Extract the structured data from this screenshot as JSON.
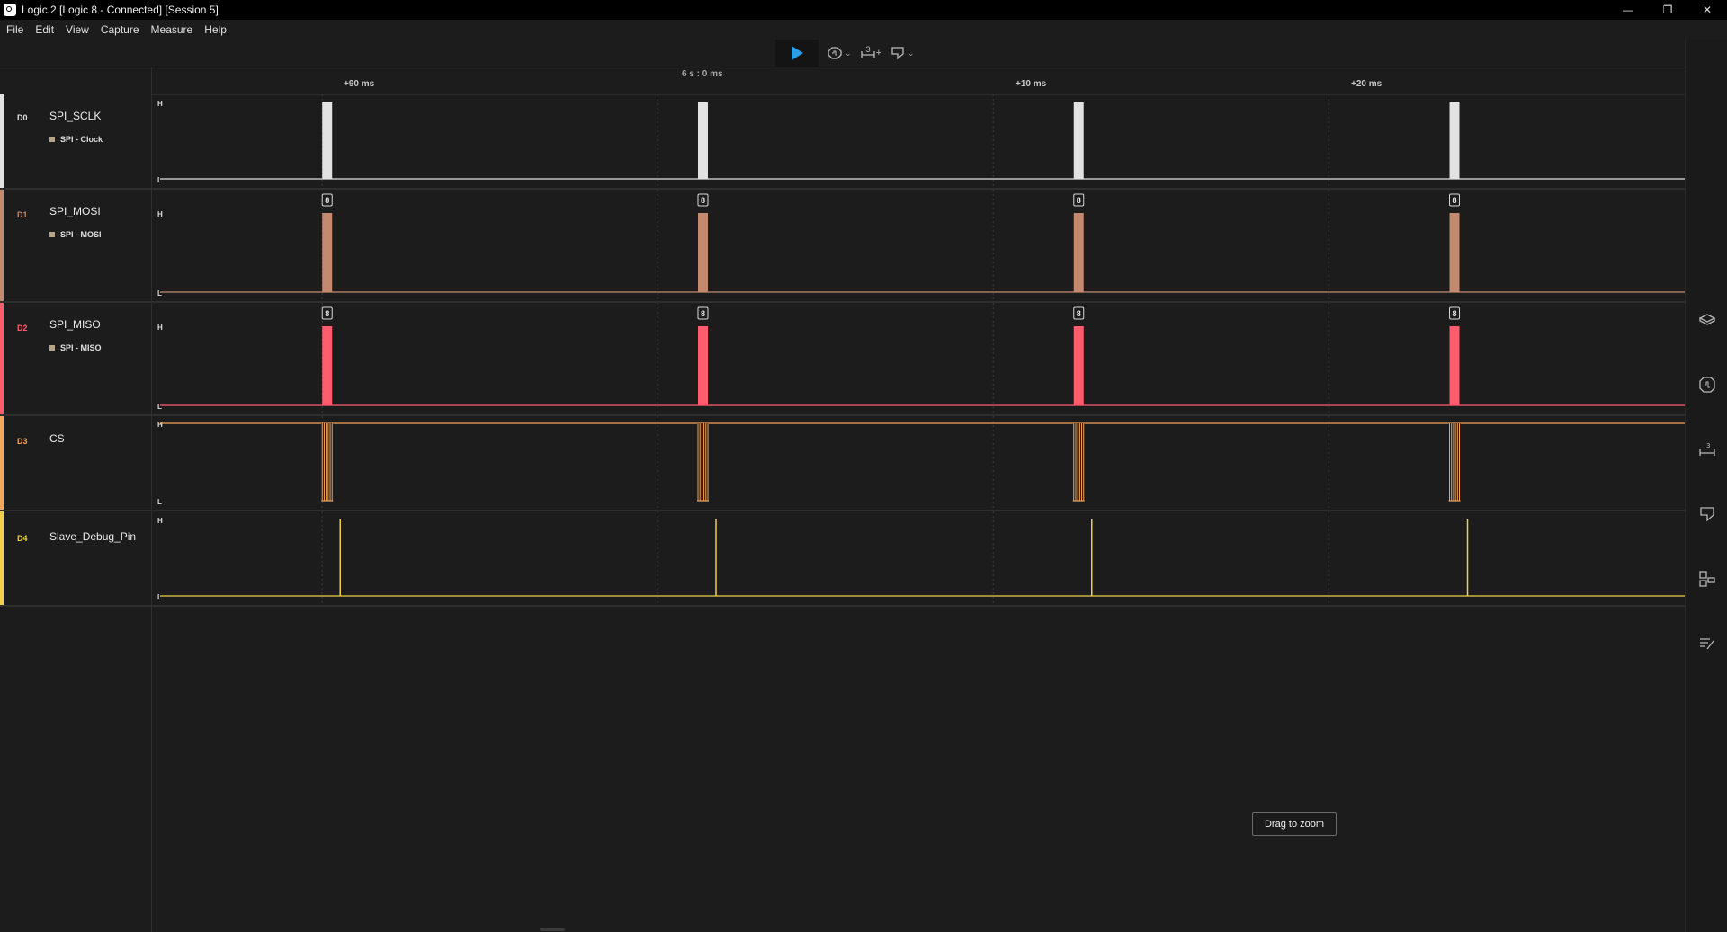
{
  "window": {
    "title": "Logic 2 [Logic 8 - Connected] [Session 5]",
    "minimize_glyph": "—",
    "restore_glyph": "❐",
    "close_glyph": "✕"
  },
  "menu": [
    "File",
    "Edit",
    "View",
    "Capture",
    "Measure",
    "Help"
  ],
  "toolbar": {
    "play_icon": "play-icon",
    "trigger_icon": "trigger-icon",
    "timing_marker_label": "3",
    "timing_marker_suffix": "+",
    "note_icon": "note-icon"
  },
  "ruler": {
    "ticks": [
      {
        "label": "+90 ms"
      },
      {
        "label": "6 s : 0 ms"
      },
      {
        "label": "+10 ms"
      },
      {
        "label": "+20 ms"
      }
    ]
  },
  "channels": [
    {
      "id": "D0",
      "name": "SPI_SCLK",
      "analyzer": "SPI - Clock",
      "color": "#e2e2e2"
    },
    {
      "id": "D1",
      "name": "SPI_MOSI",
      "analyzer": "SPI - MOSI",
      "color": "#c38a70"
    },
    {
      "id": "D2",
      "name": "SPI_MISO",
      "analyzer": "SPI - MISO",
      "color": "#ff5c6e"
    },
    {
      "id": "D3",
      "name": "CS",
      "analyzer": "",
      "color": "#f5a65b"
    },
    {
      "id": "D4",
      "name": "Slave_Debug_Pin",
      "analyzer": "",
      "color": "#f0d04a"
    }
  ],
  "levels": {
    "high": "H",
    "low": "L"
  },
  "byte_marker": "8",
  "burst_times_ms": [
    -10,
    1.2,
    12.4,
    23.6
  ],
  "tooltip": {
    "text": "Drag to zoom"
  },
  "right_bar_icons": [
    "analyzers-icon",
    "extensions-icon",
    "timing-markers-icon",
    "notes-icon",
    "device-icon",
    "annotations-icon"
  ]
}
